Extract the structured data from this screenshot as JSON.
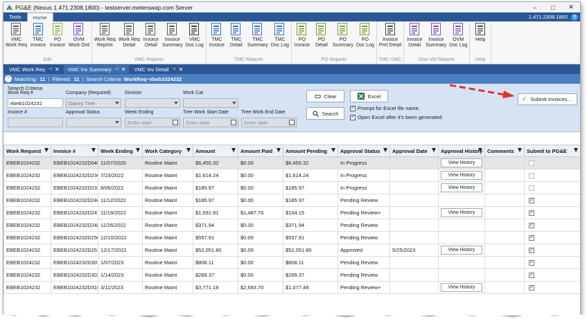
{
  "window": {
    "title": "PG&E (Nexus 1.471.2308.1800) - testserver.meterswap.com Server",
    "minimize": "–",
    "maximize": "□",
    "close": "✕"
  },
  "menu": {
    "tabs": [
      "Tools",
      "Home"
    ],
    "active": "Home",
    "version": "1.471.2308.1800",
    "help": "?"
  },
  "ribbon": {
    "groups": [
      {
        "label": "Edit",
        "buttons": [
          {
            "label": "VMC\nWork Req",
            "icon": "pencil-icon"
          },
          {
            "label": "TMC\nInvoice",
            "icon": "clock-doc-icon"
          },
          {
            "label": "PO\nInvoice",
            "icon": "po-doc-icon"
          },
          {
            "label": "OVM\nWork Ord",
            "icon": "pencil-purple-icon"
          }
        ]
      },
      {
        "label": "VMC Reports",
        "buttons": [
          {
            "label": "Work Req\nReprint",
            "icon": "report-icon"
          },
          {
            "label": "Work Req\nDetail",
            "icon": "report-icon"
          },
          {
            "label": "Invoice\nDetail",
            "icon": "report-icon"
          },
          {
            "label": "Invoice\nSummary",
            "icon": "report-icon"
          },
          {
            "label": "VMC\nDoc Log",
            "icon": "doc-log-icon"
          }
        ]
      },
      {
        "label": "TMC Reports",
        "buttons": [
          {
            "label": "TMC\nInvoice",
            "icon": "report-blue-icon"
          },
          {
            "label": "TMC\nDetail",
            "icon": "report-blue-icon"
          },
          {
            "label": "TMC\nSummary",
            "icon": "report-blue-icon"
          },
          {
            "label": "TMC\nDoc Log",
            "icon": "doc-log-blue-icon"
          }
        ]
      },
      {
        "label": "PO Reports",
        "buttons": [
          {
            "label": "PO\nInvoice",
            "icon": "report-green-icon"
          },
          {
            "label": "PO\nDetail",
            "icon": "report-green-icon"
          },
          {
            "label": "PO\nSummary",
            "icon": "report-green-icon"
          },
          {
            "label": "PO\nDoc Log",
            "icon": "doc-log-green-icon"
          }
        ]
      },
      {
        "label": "TMC-VMC",
        "buttons": [
          {
            "label": "Invoice\nPmt Detail",
            "icon": "list-icon"
          }
        ]
      },
      {
        "label": "One VM Reports",
        "buttons": [
          {
            "label": "Invoice\nDetail",
            "icon": "report-purple-icon"
          },
          {
            "label": "Invoice\nSummary",
            "icon": "report-purple-icon"
          },
          {
            "label": "OVM\nDoc Log",
            "icon": "doc-log-purple-icon"
          }
        ]
      },
      {
        "label": "Help",
        "buttons": [
          {
            "label": "Help",
            "icon": "help-icon"
          }
        ]
      }
    ]
  },
  "doc_tabs": [
    {
      "label": "VMC Work Req",
      "active": false,
      "pin": true
    },
    {
      "label": "VMC Inv Summary",
      "active": true,
      "pin": true
    },
    {
      "label": "VMC Inv Detail",
      "active": false,
      "pin": true
    }
  ],
  "matchbar": {
    "matching_label": "Matching:",
    "matching_value": "11",
    "filtered_label": "Filtered:",
    "filtered_value": "11",
    "criteria_label": "Search Criteria",
    "criteria_value": "WorkReq~ebeb1024232"
  },
  "search": {
    "title": "Search Criteria",
    "work_req_label": "Work Req #",
    "work_req_value": "ebeb1024232",
    "company_label": "Company (Required)",
    "company_value": "Davey Tree",
    "division_label": "Division",
    "work_cat_label": "Work Cat",
    "invoice_label": "Invoice #",
    "approval_label": "Approval Status",
    "week_ending_label": "Week Ending",
    "tree_start_label": "Tree Work Start Date",
    "tree_end_label": "Tree Work End Date",
    "date_placeholder": "Enter date",
    "clear_label": "Clear",
    "excel_label": "Excel",
    "search_label": "Search",
    "prompt_label": "Prompt for Excel file name.",
    "open_label": "Open Excel after it's been generated.",
    "submit_label": "Submit Invoices..."
  },
  "grid": {
    "columns": [
      "Work Request",
      "Invoice #",
      "Week Ending",
      "Work Category",
      "Amount",
      "Amount Paid",
      "Amount Pending",
      "Approval Status",
      "Approval Date",
      "Approval History",
      "Comments",
      "Submit to PG&E"
    ],
    "history_label": "View History",
    "rows": [
      {
        "wr": "EBEB1024232",
        "inv": "EBEB1024232D045",
        "week": "11/07/2020",
        "cat": "Routine Maint",
        "amt": "$6,455.32",
        "paid": "$0.00",
        "pend": "$6,455.32",
        "status": "In Progress",
        "date": "",
        "history": true,
        "comments": "",
        "submit": "disabled"
      },
      {
        "wr": "EBEB1024232",
        "inv": "EBEB1024232D230",
        "week": "7/23/2022",
        "cat": "Routine Maint",
        "amt": "$1,614.24",
        "paid": "$0.00",
        "pend": "$1,614.24",
        "status": "In Progress",
        "date": "",
        "history": true,
        "comments": "",
        "submit": "disabled"
      },
      {
        "wr": "EBEB1024232",
        "inv": "EBEB1024232D232",
        "week": "8/06/2022",
        "cat": "Routine Maint",
        "amt": "$185.97",
        "paid": "$0.00",
        "pend": "$185.97",
        "status": "In Progress",
        "date": "",
        "history": true,
        "comments": "",
        "submit": "disabled"
      },
      {
        "wr": "EBEB1024232",
        "inv": "EBEB1024232D246",
        "week": "11/12/2022",
        "cat": "Routine Maint",
        "amt": "$185.97",
        "paid": "$0.00",
        "pend": "$185.97",
        "status": "Pending Review",
        "date": "",
        "history": false,
        "comments": "",
        "submit": "checked"
      },
      {
        "wr": "EBEB1024232",
        "inv": "EBEB1024232D247",
        "week": "11/19/2022",
        "cat": "Routine Maint",
        "amt": "$1,591.91",
        "paid": "$1,487.76",
        "pend": "$104.15",
        "status": "Pending Review+",
        "date": "",
        "history": true,
        "comments": "",
        "submit": "checked"
      },
      {
        "wr": "EBEB1024232",
        "inv": "EBEB1024232D248",
        "week": "11/26/2022",
        "cat": "Routine Maint",
        "amt": "$371.94",
        "paid": "$0.00",
        "pend": "$371.94",
        "status": "Pending Review",
        "date": "",
        "history": false,
        "comments": "",
        "submit": "checked"
      },
      {
        "wr": "EBEB1024232",
        "inv": "EBEB1024232D250",
        "week": "12/10/2022",
        "cat": "Routine Maint",
        "amt": "$557.91",
        "paid": "$0.00",
        "pend": "$557.91",
        "status": "Pending Review",
        "date": "",
        "history": false,
        "comments": "",
        "submit": "checked"
      },
      {
        "wr": "EBEB1024232",
        "inv": "EBEB1024232D251",
        "week": "12/17/2022",
        "cat": "Routine Maint",
        "amt": "$52,051.80",
        "paid": "$0.00",
        "pend": "$52,051.80",
        "status": "Approved",
        "date": "5/25/2023",
        "history": true,
        "comments": "",
        "submit": "checked"
      },
      {
        "wr": "EBEB1024232",
        "inv": "EBEB1024232D301",
        "week": "1/07/2023",
        "cat": "Routine Maint",
        "amt": "$808.11",
        "paid": "$0.00",
        "pend": "$808.11",
        "status": "Pending Review",
        "date": "",
        "history": false,
        "comments": "",
        "submit": "checked"
      },
      {
        "wr": "EBEB1024232",
        "inv": "EBEB1024232D302",
        "week": "1/14/2023",
        "cat": "Routine Maint",
        "amt": "$269.37",
        "paid": "$0.00",
        "pend": "$269.37",
        "status": "Pending Review",
        "date": "",
        "history": false,
        "comments": "",
        "submit": "checked"
      },
      {
        "wr": "EBEB1024232",
        "inv": "EBEB1024232D310",
        "week": "3/11/2023",
        "cat": "Routine Maint",
        "amt": "$3,771.18",
        "paid": "$2,693.70",
        "pend": "$1,077.48",
        "status": "Pending Review+",
        "date": "",
        "history": true,
        "comments": "",
        "submit": "checked"
      }
    ]
  },
  "colors": {
    "menu_bg": "#2b5797",
    "match_bg": "#4a7fc1",
    "search_bg": "#d6e3f4",
    "arrow": "#e0342a",
    "check_green": "#2e9e3b"
  }
}
